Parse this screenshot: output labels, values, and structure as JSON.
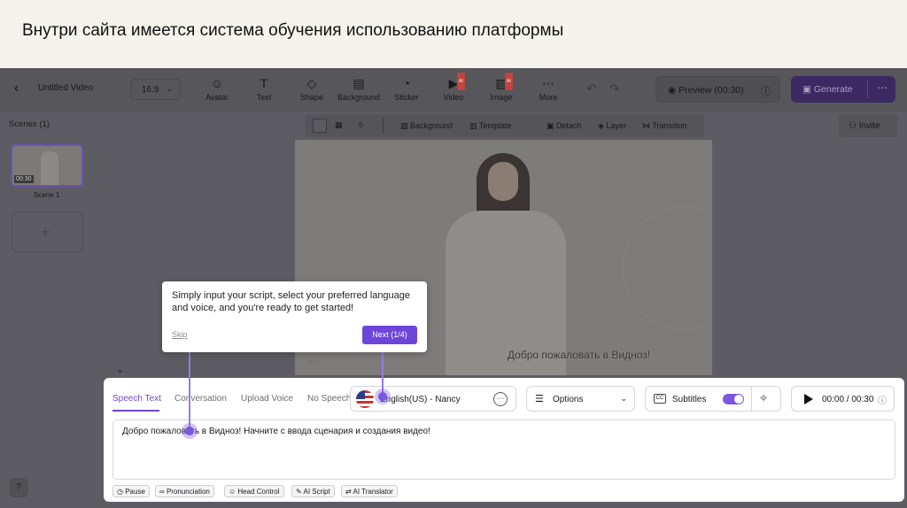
{
  "banner": {
    "title": "Внутри сайта имеется система обучения использованию платформы"
  },
  "topbar": {
    "project_title": "Untitled Video",
    "ratio": "16:9",
    "tools": [
      {
        "label": "Avatar",
        "icon": "avatar-icon",
        "glyph": "☺"
      },
      {
        "label": "Text",
        "icon": "text-icon",
        "glyph": "T"
      },
      {
        "label": "Shape",
        "icon": "shape-icon",
        "glyph": "◇"
      },
      {
        "label": "Background",
        "icon": "background-icon",
        "glyph": "▤"
      },
      {
        "label": "Sticker",
        "icon": "sticker-icon",
        "glyph": "◔"
      },
      {
        "label": "Video",
        "icon": "video-icon",
        "glyph": "▶",
        "badge": "AI"
      },
      {
        "label": "Image",
        "icon": "image-icon",
        "glyph": "▨",
        "badge": "AI"
      },
      {
        "label": "More",
        "icon": "more-icon",
        "glyph": "⋯"
      }
    ],
    "preview_label": "Preview (00:30)",
    "generate_label": "Generate"
  },
  "sidebar": {
    "title": "Scenes (1)",
    "scenes": [
      {
        "label": "Scene 1",
        "duration": "00:30"
      }
    ]
  },
  "canvas_toolbar": {
    "background": "Background",
    "template": "Template",
    "detach": "Detach",
    "layer": "Layer",
    "transition": "Transition"
  },
  "invite_label": "Invite",
  "canvas": {
    "caption": "Добро пожаловать в Видноз!"
  },
  "speech_panel": {
    "tabs": [
      "Speech Text",
      "Conversation",
      "Upload Voice",
      "No Speech"
    ],
    "voice": "English(US) - Nancy",
    "options_label": "Options",
    "subtitles_label": "Subtitles",
    "time": "00:00 / 00:30",
    "script": "Добро пожаловать в Видноз! Начните с ввода сценария и создания видео!",
    "chips": [
      "Pause",
      "Pronunciation",
      "Head Control",
      "AI Script",
      "AI Translator"
    ]
  },
  "tooltip": {
    "text": "Simply input your script, select your preferred language and voice, and you're ready to get started!",
    "skip": "Skip",
    "next": "Next (1/4)"
  },
  "colors": {
    "accent": "#6d46d9",
    "overlay": "#5c5c62"
  }
}
